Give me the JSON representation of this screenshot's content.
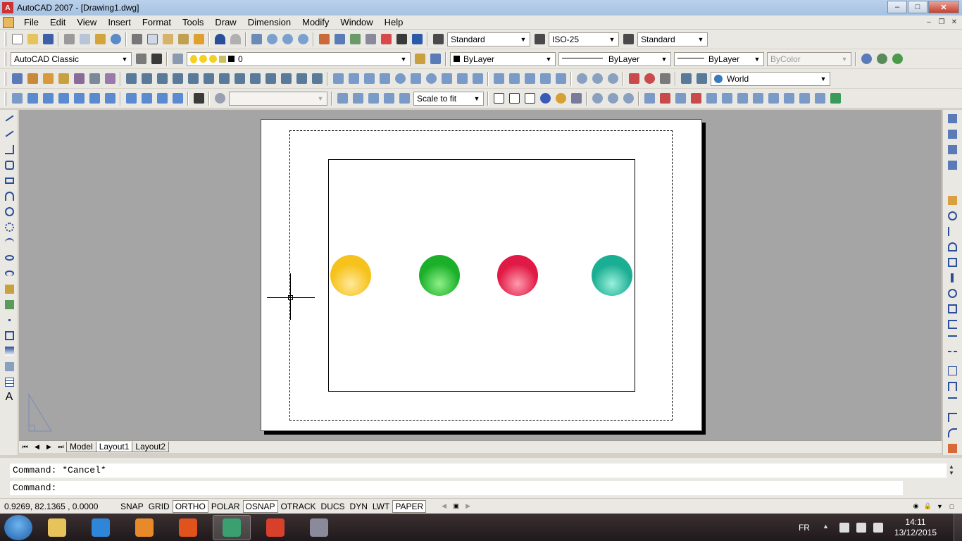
{
  "window": {
    "title": "AutoCAD 2007 - [Drawing1.dwg]",
    "minimize": "–",
    "maximize": "□",
    "close": "✕"
  },
  "menu": [
    "File",
    "Edit",
    "View",
    "Insert",
    "Format",
    "Tools",
    "Draw",
    "Dimension",
    "Modify",
    "Window",
    "Help"
  ],
  "styles_toolbar": {
    "text_style": "Standard",
    "dim_style": "ISO-25",
    "table_style": "Standard"
  },
  "workspace": "AutoCAD Classic",
  "layer": "0",
  "properties": {
    "color": "ByLayer",
    "linetype": "ByLayer",
    "lineweight": "ByLayer",
    "plotstyle": "ByColor"
  },
  "ucs": "World",
  "viewport_scale": "Scale to fit",
  "balls": [
    {
      "name": "yellow",
      "color": "#f6c21c",
      "light": "#ffe89a"
    },
    {
      "name": "green",
      "color": "#1cb02a",
      "light": "#8ef08a"
    },
    {
      "name": "red",
      "color": "#e01a45",
      "light": "#ff9aae"
    },
    {
      "name": "teal",
      "color": "#1aae92",
      "light": "#9af0dc"
    }
  ],
  "layout_tabs": [
    "Model",
    "Layout1",
    "Layout2"
  ],
  "active_tab": "Layout1",
  "command_line": {
    "history": "Command: *Cancel*",
    "prompt": "Command:"
  },
  "status": {
    "coordinates": "0.9269,  82.1365 , 0.0000",
    "buttons": [
      "SNAP",
      "GRID",
      "ORTHO",
      "POLAR",
      "OSNAP",
      "OTRACK",
      "DUCS",
      "DYN",
      "LWT",
      "PAPER"
    ],
    "on": [
      "ORTHO",
      "OSNAP",
      "PAPER"
    ]
  },
  "taskbar": {
    "language": "FR",
    "time": "14:11",
    "date": "13/12/2015",
    "apps": [
      {
        "name": "explorer",
        "color": "#e7c35c"
      },
      {
        "name": "internet-explorer",
        "color": "#2f86d8"
      },
      {
        "name": "media-player",
        "color": "#e88a2a"
      },
      {
        "name": "firefox",
        "color": "#e0531c"
      },
      {
        "name": "autocad",
        "color": "#3aa070"
      },
      {
        "name": "chrome",
        "color": "#d9402c"
      },
      {
        "name": "winrar",
        "color": "#8a8a9a"
      }
    ]
  },
  "colors": {
    "canvas_bg": "#a5a5a5",
    "chrome_bg": "#eae8e3"
  }
}
